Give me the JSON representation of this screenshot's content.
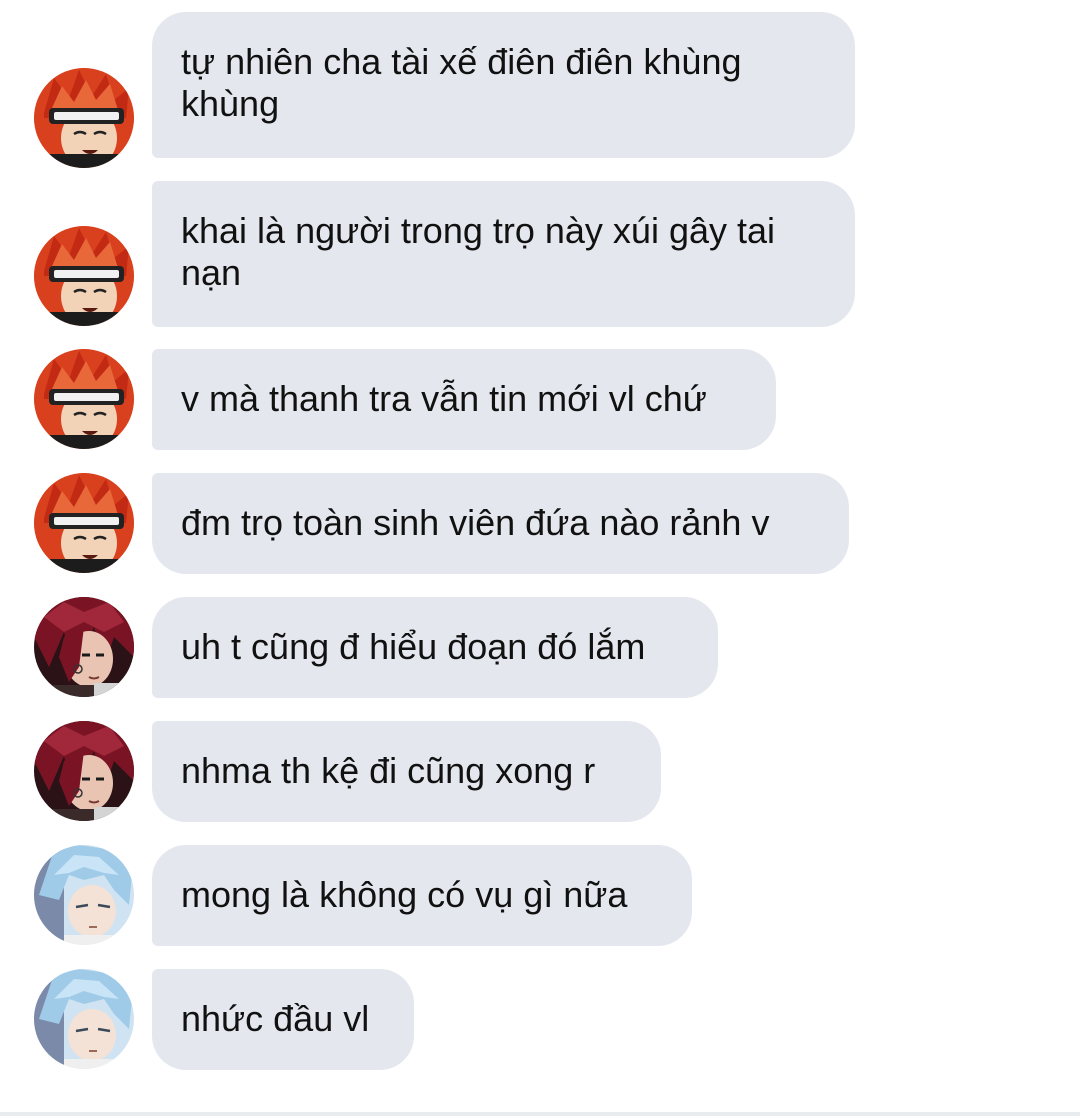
{
  "messages": [
    {
      "sender_avatar": "red-hair-headband-avatar",
      "text": "tự nhiên cha tài xế điên điên khùng khùng"
    },
    {
      "sender_avatar": "red-hair-headband-avatar",
      "text": "khai là người trong trọ này xúi gây tai nạn"
    },
    {
      "sender_avatar": "red-hair-headband-avatar",
      "text": "v mà thanh tra vẫn tin mới vl chứ"
    },
    {
      "sender_avatar": "red-hair-headband-avatar",
      "text": "đm trọ toàn sinh viên đứa nào rảnh v"
    },
    {
      "sender_avatar": "dark-red-hair-avatar",
      "text": "uh t cũng đ hiểu đoạn đó lắm"
    },
    {
      "sender_avatar": "dark-red-hair-avatar",
      "text": "nhma th kệ đi cũng xong r"
    },
    {
      "sender_avatar": "blue-hair-avatar",
      "text": "mong là không có vụ gì nữa"
    },
    {
      "sender_avatar": "blue-hair-avatar",
      "text": "nhức đầu vl"
    }
  ],
  "colors": {
    "bubble_bg": "#e4e8ee",
    "text": "#111111",
    "background": "#ffffff"
  }
}
